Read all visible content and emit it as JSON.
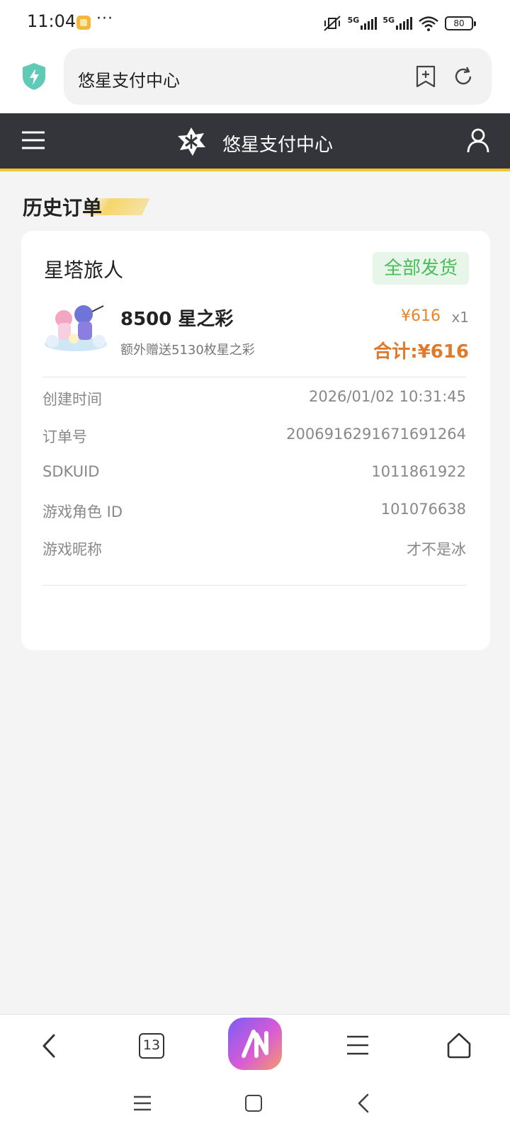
{
  "status_bar": {
    "time": "11:04",
    "more": "···",
    "signal1_label": "5G",
    "signal2_label": "5G",
    "battery": "80"
  },
  "browser": {
    "address": "悠星支付中心"
  },
  "header": {
    "title": "悠星支付中心"
  },
  "section": {
    "title": "历史订单"
  },
  "order": {
    "game_name": "星塔旅人",
    "status": "全部发货",
    "product_name": "8500 星之彩",
    "product_bonus": "额外赠送5130枚星之彩",
    "unit_price": "¥616",
    "quantity": "x1",
    "total": "合计:¥616",
    "details": [
      {
        "label": "创建时间",
        "value": "2026/01/02 10:31:45"
      },
      {
        "label": "订单号",
        "value": "2006916291671691264"
      },
      {
        "label": "SDKUID",
        "value": "1011861922"
      },
      {
        "label": "游戏角色 ID",
        "value": "101076638"
      },
      {
        "label": "游戏昵称",
        "value": "才不是冰"
      }
    ]
  },
  "bottom_nav": {
    "tabs_count": "13"
  },
  "colors": {
    "header_bg": "#33353b",
    "header_accent": "#f2c62e",
    "status_green": "#4cbc5c",
    "price_orange": "#e07a2a"
  }
}
